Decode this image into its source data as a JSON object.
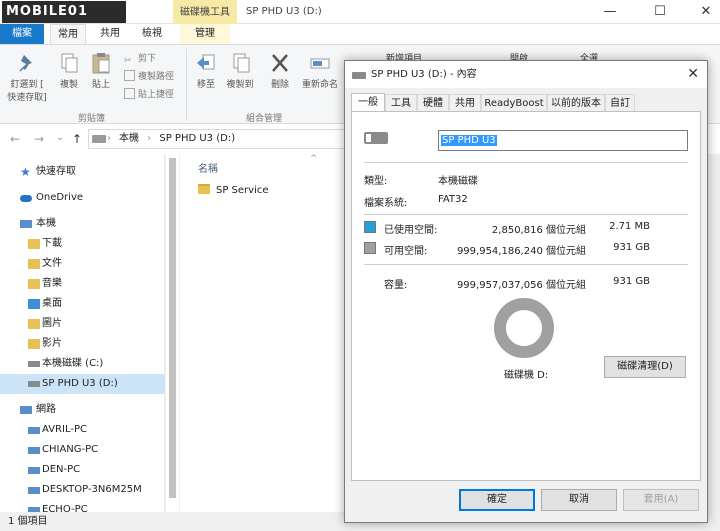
{
  "titlebar": {
    "logo": "MOBILE01",
    "context_tab": "磁碟機工具",
    "path": "SP PHD U3 (D:)",
    "minimize": "—",
    "maximize": "☐",
    "close": "✕"
  },
  "ribbon_tabs": {
    "file": "檔案",
    "home": "常用",
    "share": "共用",
    "view": "檢視",
    "manage": "管理"
  },
  "ribbon": {
    "pin": "釘選到 [",
    "pin2": "快速存取]",
    "copy": "複製",
    "paste": "貼上",
    "cut": "剪下",
    "copy_path": "複製路徑",
    "paste_shortcut": "貼上捷徑",
    "clipboard_group": "剪貼簿",
    "move_to": "移至",
    "copy_to": "複製到",
    "delete": "刪除",
    "rename": "重新命名",
    "organize_group": "組合管理",
    "new_item": "新增項目",
    "open": "開啟",
    "select_all": "全選"
  },
  "address": {
    "back": "←",
    "forward": "→",
    "dropdown": "⌄",
    "up": "↑",
    "crumb_root": "本機",
    "crumb_sep": "›",
    "crumb_drive": "SP PHD U3 (D:)"
  },
  "nav": {
    "quick_access": "快速存取",
    "onedrive": "OneDrive",
    "this_pc": "本機",
    "downloads": "下載",
    "documents": "文件",
    "music": "音樂",
    "desktop": "桌面",
    "pictures": "圖片",
    "videos": "影片",
    "local_disk": "本機磁碟 (C:)",
    "sp_drive": "SP PHD U3 (D:)",
    "network": "網路",
    "pc1": "AVRIL-PC",
    "pc2": "CHIANG-PC",
    "pc3": "DEN-PC",
    "pc4": "DESKTOP-3N6M25M",
    "pc5": "ECHO-PC"
  },
  "content": {
    "col_name": "名稱",
    "sort_arrow": "^",
    "file1": "SP Service"
  },
  "status": {
    "count": "1 個項目"
  },
  "dialog": {
    "title": "SP PHD U3 (D:) - 內容",
    "close": "✕",
    "tabs": [
      "一般",
      "工具",
      "硬體",
      "共用",
      "ReadyBoost",
      "以前的版本",
      "自訂"
    ],
    "volume_name": "SP PHD U3",
    "type_label": "類型:",
    "type_value": "本機磁碟",
    "fs_label": "檔案系統:",
    "fs_value": "FAT32",
    "used_label": "已使用空間:",
    "used_bytes": "2,850,816 個位元組",
    "used_size": "2.71 MB",
    "free_label": "可用空間:",
    "free_bytes": "999,954,186,240 個位元組",
    "free_size": "931 GB",
    "cap_label": "容量:",
    "cap_bytes": "999,957,037,056 個位元組",
    "cap_size": "931 GB",
    "drive_label": "磁碟機 D:",
    "cleanup": "磁碟清理(D)",
    "ok": "確定",
    "cancel": "取消",
    "apply": "套用(A)",
    "used_color": "#26a0da",
    "free_color": "#a0a0a0"
  }
}
